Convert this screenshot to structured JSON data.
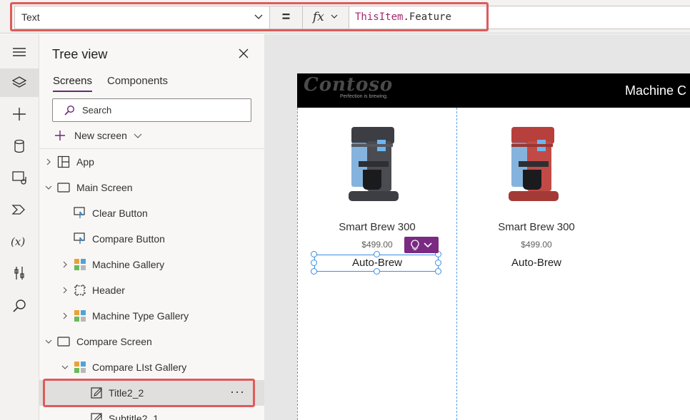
{
  "formula_bar": {
    "property": "Text",
    "equals": "=",
    "fx": "fx",
    "formula_object": "ThisItem",
    "formula_rest": ".Feature"
  },
  "tree_view": {
    "title": "Tree view",
    "tabs": [
      "Screens",
      "Components"
    ],
    "search_placeholder": "Search",
    "new_screen": "New screen",
    "items": [
      {
        "label": "App"
      },
      {
        "label": "Main Screen"
      },
      {
        "label": "Clear Button"
      },
      {
        "label": "Compare Button"
      },
      {
        "label": "Machine Gallery"
      },
      {
        "label": "Header"
      },
      {
        "label": "Machine Type Gallery"
      },
      {
        "label": "Compare Screen"
      },
      {
        "label": "Compare LIst Gallery"
      },
      {
        "label": "Title2_2"
      },
      {
        "label": "Subtitle2_1"
      }
    ],
    "more": "···"
  },
  "canvas": {
    "logo": "Contoso",
    "tagline": "Perfection is brewing.",
    "header_title": "Machine C",
    "cards": [
      {
        "name": "Smart Brew 300",
        "price": "$499.00",
        "feature": "Auto-Brew",
        "color": "#4a4c52"
      },
      {
        "name": "Smart Brew 300",
        "price": "$499.00",
        "feature": "Auto-Brew",
        "color": "#c24a46"
      }
    ]
  },
  "colors": {
    "accent": "#6b2776",
    "highlight": "#e05a5a",
    "selection": "#3a8ee6"
  }
}
